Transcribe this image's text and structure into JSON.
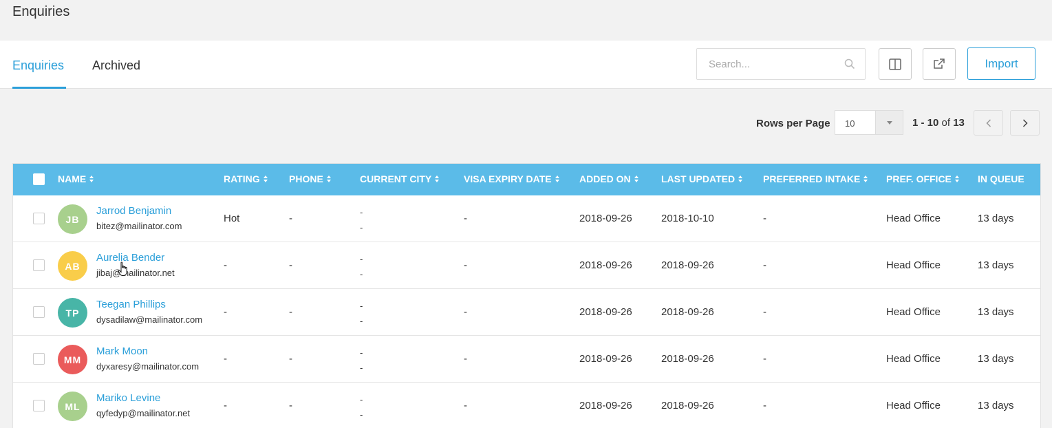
{
  "page_title": "Enquiries",
  "tabs": [
    {
      "label": "Enquiries",
      "active": true
    },
    {
      "label": "Archived",
      "active": false
    }
  ],
  "search": {
    "placeholder": "Search...",
    "value": ""
  },
  "toolbar": {
    "import_label": "Import",
    "columns_icon": "columns-icon",
    "export_icon": "external-link-icon"
  },
  "pagination": {
    "rows_per_page_label": "Rows per Page",
    "rows_per_page_value": "10",
    "range": "1 - 10",
    "of_label": "of",
    "total": "13"
  },
  "table": {
    "headers": {
      "name": "NAME",
      "rating": "RATING",
      "phone": "PHONE",
      "city": "CURRENT CITY",
      "visa": "VISA EXPIRY DATE",
      "added": "ADDED ON",
      "updated": "LAST UPDATED",
      "intake": "PREFERRED INTAKE",
      "office": "PREF. OFFICE",
      "queue": "IN QUEUE"
    },
    "rows": [
      {
        "initials": "JB",
        "avatar_color": "#a8d08d",
        "name": "Jarrod Benjamin",
        "email": "bitez@mailinator.com",
        "rating": "Hot",
        "phone": "-",
        "city1": "-",
        "city2": "-",
        "visa": "-",
        "added": "2018-09-26",
        "updated": "2018-10-10",
        "intake": "-",
        "office": "Head Office",
        "queue": "13 days"
      },
      {
        "initials": "AB",
        "avatar_color": "#f9cd4a",
        "name": "Aurelia Bender",
        "email": "jibaj@mailinator.net",
        "rating": "-",
        "phone": "-",
        "city1": "-",
        "city2": "-",
        "visa": "-",
        "added": "2018-09-26",
        "updated": "2018-09-26",
        "intake": "-",
        "office": "Head Office",
        "queue": "13 days"
      },
      {
        "initials": "TP",
        "avatar_color": "#48b5a7",
        "name": "Teegan Phillips",
        "email": "dysadilaw@mailinator.com",
        "rating": "-",
        "phone": "-",
        "city1": "-",
        "city2": "-",
        "visa": "-",
        "added": "2018-09-26",
        "updated": "2018-09-26",
        "intake": "-",
        "office": "Head Office",
        "queue": "13 days"
      },
      {
        "initials": "MM",
        "avatar_color": "#ea5b5b",
        "name": "Mark Moon",
        "email": "dyxaresy@mailinator.com",
        "rating": "-",
        "phone": "-",
        "city1": "-",
        "city2": "-",
        "visa": "-",
        "added": "2018-09-26",
        "updated": "2018-09-26",
        "intake": "-",
        "office": "Head Office",
        "queue": "13 days"
      },
      {
        "initials": "ML",
        "avatar_color": "#a8d08d",
        "name": "Mariko Levine",
        "email": "qyfedyp@mailinator.net",
        "rating": "-",
        "phone": "-",
        "city1": "-",
        "city2": "-",
        "visa": "-",
        "added": "2018-09-26",
        "updated": "2018-09-26",
        "intake": "-",
        "office": "Head Office",
        "queue": "13 days"
      }
    ]
  }
}
